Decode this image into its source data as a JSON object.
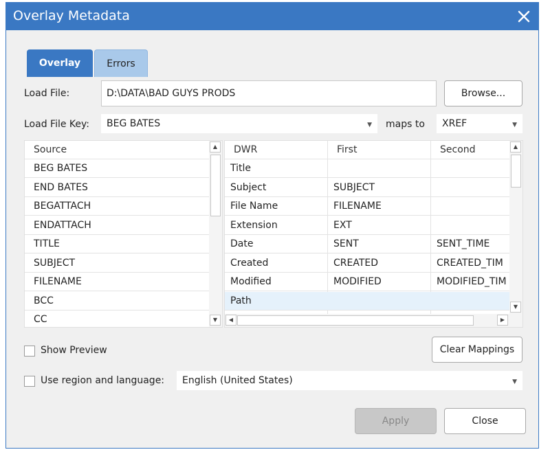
{
  "window": {
    "title": "Overlay Metadata"
  },
  "tabs": [
    {
      "label": "Overlay"
    },
    {
      "label": "Errors"
    }
  ],
  "load_file": {
    "label": "Load File:",
    "value": "D:\\DATA\\BAD GUYS PRODS",
    "browse_label": "Browse..."
  },
  "load_file_key": {
    "label": "Load File Key:",
    "value": "BEG BATES",
    "maps_to_label": "maps to",
    "maps_to_value": "XREF"
  },
  "source_list": {
    "header": "Source",
    "items": [
      "BEG BATES",
      "END BATES",
      "BEGATTACH",
      "ENDATTACH",
      "TITLE",
      "SUBJECT",
      "FILENAME",
      "BCC",
      "CC"
    ]
  },
  "mapping_grid": {
    "headers": [
      "DWR",
      "First",
      "Second"
    ],
    "rows": [
      [
        "Title",
        "",
        ""
      ],
      [
        "Subject",
        "SUBJECT",
        ""
      ],
      [
        "File Name",
        "FILENAME",
        ""
      ],
      [
        "Extension",
        "EXT",
        ""
      ],
      [
        "Date",
        "SENT",
        "SENT_TIME"
      ],
      [
        "Created",
        "CREATED",
        "CREATED_TIM"
      ],
      [
        "Modified",
        "MODIFIED",
        "MODIFIED_TIM"
      ],
      [
        "Path",
        "",
        ""
      ]
    ],
    "selected_row": 7,
    "selected_color": "#e5f1fb"
  },
  "show_preview": {
    "label": "Show Preview",
    "checked": false
  },
  "clear_mappings_label": "Clear Mappings",
  "region": {
    "label": "Use region and language:",
    "checked": false,
    "value": "English (United States)"
  },
  "footer": {
    "apply_label": "Apply",
    "apply_enabled": false,
    "close_label": "Close"
  },
  "colors": {
    "accent": "#3a78c3",
    "tab_inactive": "#a9c9ea"
  }
}
